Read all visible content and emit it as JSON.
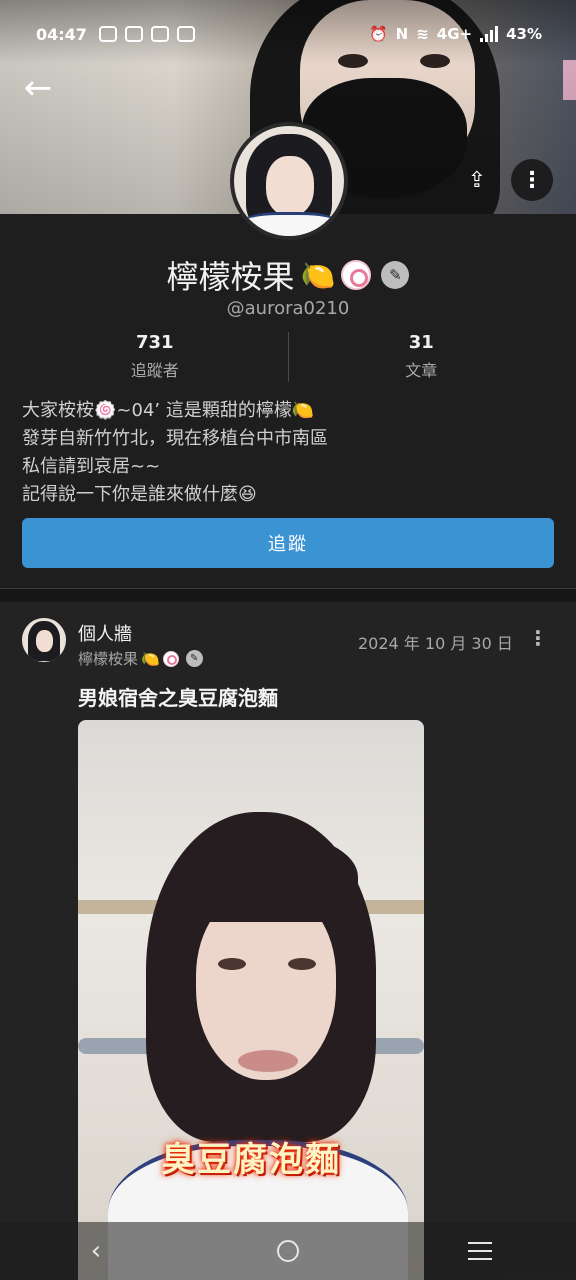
{
  "status_bar": {
    "time": "04:47",
    "network": "4G+",
    "battery": "43%"
  },
  "header": {
    "back_icon": "arrow-left-icon",
    "share_icon": "share-icon",
    "more_icon": "more-vertical-icon"
  },
  "profile": {
    "name": "檸檬桉果",
    "name_emoji": "🍋",
    "handle": "@aurora0210",
    "stats": [
      {
        "value": "731",
        "label": "追蹤者"
      },
      {
        "value": "31",
        "label": "文章"
      }
    ],
    "bio": [
      "大家桉桉🍥~04’ 這是顆甜的檸檬🍋",
      "發芽自新竹竹北，現在移植台中市南區",
      "私信請到哀居~~",
      "記得說一下你是誰來做什麼😆"
    ],
    "follow_label": "追蹤"
  },
  "post": {
    "board": "個人牆",
    "author": "檸檬桉果",
    "author_emoji": "🍋",
    "date": "2024 年 10 月 30 日",
    "title": "男娘宿舍之臭豆腐泡麵",
    "image_caption": "臭豆腐泡麵"
  },
  "navbar": {
    "back": "‹"
  },
  "colors": {
    "background": "#1e1e1e",
    "card": "#232323",
    "follow_button": "#3b93d4",
    "muted_text": "#a8a8a8"
  }
}
